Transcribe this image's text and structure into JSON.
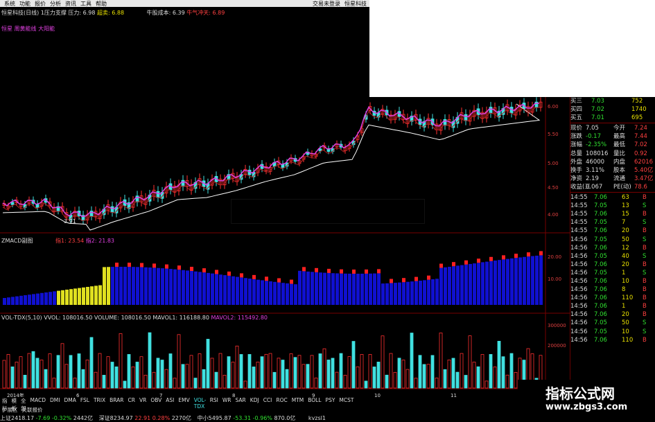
{
  "menu": {
    "items": [
      "系统",
      "功能",
      "报价",
      "分析",
      "资讯",
      "工具",
      "帮助"
    ],
    "right": [
      "交易未登录",
      "恒星科技"
    ]
  },
  "main_header": {
    "title": "恒星科技(日线)",
    "indicator": "1压力支撑 压力: 6.98",
    "support": "超卖: 6.88",
    "cost": "牛股成本: 6.39",
    "cost2": "牛气冲天: 6.89",
    "sub": "恒星 周黄能线 大阳能"
  },
  "price_axis": [
    "6.00",
    "5.50",
    "5.00",
    "4.50",
    "4.00"
  ],
  "annotations": {
    "low": "3.91"
  },
  "macd_header": {
    "title": "ZMACD副图",
    "v1": "指1: 23.54",
    "v2": "指2: 21.83"
  },
  "macd_axis": [
    "20.00",
    "10.00"
  ],
  "vol_header": {
    "title": "VOL-TDX(5,10)",
    "vvol": "VVOL: 108016.50",
    "volume": "VOLUME: 108016.50",
    "mavol1": "MAVOL1: 116188.80",
    "mavol2": "MAVOL2: 115492.80"
  },
  "vol_axis": [
    "300000",
    "200000",
    "100000"
  ],
  "x_labels": [
    "2014年",
    "6",
    "7",
    "8",
    "9",
    "10",
    "11"
  ],
  "tabs": [
    "指标",
    "模板",
    "全部",
    "MACD",
    "DMI",
    "DMA",
    "FSL",
    "TRIX",
    "BRAR",
    "CR",
    "VR",
    "OBV",
    "ASI",
    "EMV",
    "VOL-TDX",
    "RSI",
    "WR",
    "SAR",
    "KDJ",
    "CCI",
    "ROC",
    "MTM",
    "BOLL",
    "PSY",
    "MCST"
  ],
  "tabs2": [
    "扩展区",
    "关联报价"
  ],
  "quote": {
    "asks": [
      {
        "label": "买三",
        "price": "7.03",
        "vol": "752"
      },
      {
        "label": "买四",
        "price": "7.02",
        "vol": "1740"
      },
      {
        "label": "买五",
        "price": "7.01",
        "vol": "695"
      }
    ],
    "stats": [
      {
        "l1": "现价",
        "v1": "7.05",
        "l2": "今开",
        "v2": "7.24"
      },
      {
        "l1": "涨跌",
        "v1": "-0.17",
        "l2": "最高",
        "v2": "7.44"
      },
      {
        "l1": "涨幅",
        "v1": "-2.35%",
        "l2": "最低",
        "v2": "7.02"
      },
      {
        "l1": "总量",
        "v1": "108016",
        "l2": "量比",
        "v2": "0.92"
      },
      {
        "l1": "外盘",
        "v1": "46000",
        "l2": "内盘",
        "v2": "62016"
      },
      {
        "l1": "换手",
        "v1": "3.11%",
        "l2": "股本",
        "v2": "5.40亿"
      },
      {
        "l1": "净资",
        "v1": "2.19",
        "l2": "流通",
        "v2": "3.47亿"
      },
      {
        "l1": "收益(三",
        "v1": "0.067",
        "l2": "PE(动)",
        "v2": "78.6"
      }
    ],
    "ticks": [
      {
        "t": "14:55",
        "p": "7.06",
        "v": "63",
        "s": "B"
      },
      {
        "t": "14:55",
        "p": "7.05",
        "v": "13",
        "s": "S"
      },
      {
        "t": "14:55",
        "p": "7.06",
        "v": "15",
        "s": "B"
      },
      {
        "t": "14:55",
        "p": "7.05",
        "v": "7",
        "s": "S"
      },
      {
        "t": "14:55",
        "p": "7.06",
        "v": "20",
        "s": "B"
      },
      {
        "t": "14:56",
        "p": "7.05",
        "v": "50",
        "s": "S"
      },
      {
        "t": "14:56",
        "p": "7.06",
        "v": "12",
        "s": "B"
      },
      {
        "t": "14:56",
        "p": "7.05",
        "v": "40",
        "s": "S"
      },
      {
        "t": "14:56",
        "p": "7.06",
        "v": "20",
        "s": "B"
      },
      {
        "t": "14:56",
        "p": "7.05",
        "v": "1",
        "s": "S"
      },
      {
        "t": "14:56",
        "p": "7.06",
        "v": "10",
        "s": "B"
      },
      {
        "t": "14:56",
        "p": "7.06",
        "v": "8",
        "s": "B"
      },
      {
        "t": "14:56",
        "p": "7.06",
        "v": "110",
        "s": "B"
      },
      {
        "t": "14:56",
        "p": "7.06",
        "v": "1",
        "s": "B"
      },
      {
        "t": "14:56",
        "p": "7.06",
        "v": "20",
        "s": "B"
      },
      {
        "t": "14:56",
        "p": "7.05",
        "v": "50",
        "s": "S"
      },
      {
        "t": "14:56",
        "p": "7.05",
        "v": "10",
        "s": "S"
      },
      {
        "t": "14:56",
        "p": "7.06",
        "v": "110",
        "s": "B"
      }
    ]
  },
  "bottom": {
    "sh": "上证2418.17",
    "sh_chg": "-7.69",
    "sh_pct": "-0.32%",
    "sh_amt": "2442亿",
    "sz": "深证8234.97",
    "sz_chg": "22.91",
    "sz_pct": "0.28%",
    "sz_amt": "2270亿",
    "zx": "中小5495.87",
    "zx_chg": "-53.31",
    "zx_pct": "-0.96%",
    "zx_amt": "870.0亿",
    "extra": "kvzsl1"
  },
  "watermark": {
    "title": "指标公式网",
    "url": "www.zbgs3.com"
  },
  "colors": {
    "up": "#ff3030",
    "down": "#40e0e0",
    "macd_bar": "#1010d0",
    "ma5": "#ffffff",
    "ma10": "#e040e0",
    "ma20": "#ff4040"
  }
}
